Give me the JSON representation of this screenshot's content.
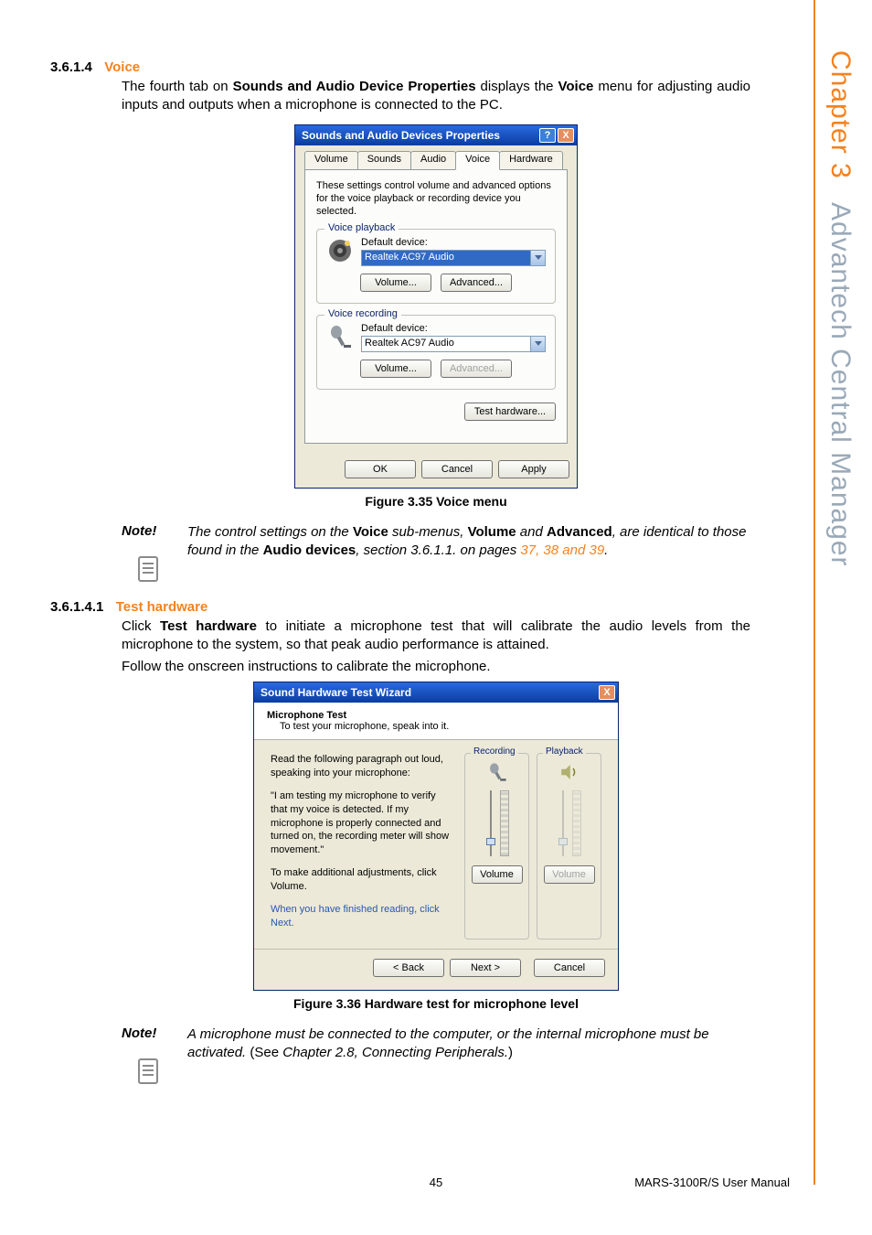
{
  "side": {
    "chapter": "Chapter 3",
    "title": "Advantech Central Manager"
  },
  "s1": {
    "num": "3.6.1.4",
    "title": "Voice",
    "p_a": "The fourth tab on ",
    "p_b": "Sounds and Audio Device Properties",
    "p_c": " displays the ",
    "p_d": "Voice",
    "p_e": " menu for adjusting audio inputs and outputs when a microphone is connected to the PC."
  },
  "dlg1": {
    "title": "Sounds and Audio Devices Properties",
    "tabs": {
      "t1": "Volume",
      "t2": "Sounds",
      "t3": "Audio",
      "t4": "Voice",
      "t5": "Hardware"
    },
    "desc": "These settings control volume and advanced options for the voice playback or recording device you selected.",
    "g1": "Voice playback",
    "g2": "Voice recording",
    "def": "Default device:",
    "dev": "Realtek AC97 Audio",
    "vol": "Volume...",
    "adv": "Advanced...",
    "test": "Test hardware...",
    "ok": "OK",
    "cancel": "Cancel",
    "apply": "Apply"
  },
  "fig1": "Figure 3.35 Voice menu",
  "note1": {
    "label": "Note!",
    "a": "The control settings on the ",
    "b": "Voice",
    "c": " sub-menus, ",
    "d": "Volume",
    "e": " and ",
    "f": "Advanced",
    "g": ", are identical to those found in the ",
    "h": "Audio devices",
    "i": ", section 3.6.1.1. on pages ",
    "j": "37, 38 and 39",
    "k": "."
  },
  "s2": {
    "num": "3.6.1.4.1",
    "title": "Test hardware",
    "p1a": "Click ",
    "p1b": "Test hardware",
    "p1c": " to initiate a microphone test that will calibrate the audio levels from the microphone to the system, so that peak audio performance is attained.",
    "p2": "Follow the onscreen instructions to calibrate the microphone."
  },
  "dlg2": {
    "title": "Sound Hardware Test Wizard",
    "h1": "Microphone Test",
    "h2": "To test your microphone, speak into it.",
    "p1": "Read the following paragraph out loud, speaking into your microphone:",
    "p2": "\"I am testing my microphone to verify that my voice is detected. If my microphone is properly connected and turned on, the recording meter will show movement.\"",
    "p3": "To make additional adjustments, click Volume.",
    "p4": "When you have finished reading, click Next.",
    "rec": "Recording",
    "pb": "Playback",
    "vol": "Volume",
    "back": "< Back",
    "next": "Next >",
    "cancel": "Cancel"
  },
  "fig2": "Figure 3.36 Hardware test for microphone level",
  "note2": {
    "label": "Note!",
    "a": "A microphone must be connected to the computer, or the internal microphone must be activated. ",
    "b": "(See ",
    "c": "Chapter 2.8, Connecting Peripherals.",
    "d": ")"
  },
  "footer": {
    "page": "45",
    "doc": "MARS-3100R/S User Manual"
  }
}
